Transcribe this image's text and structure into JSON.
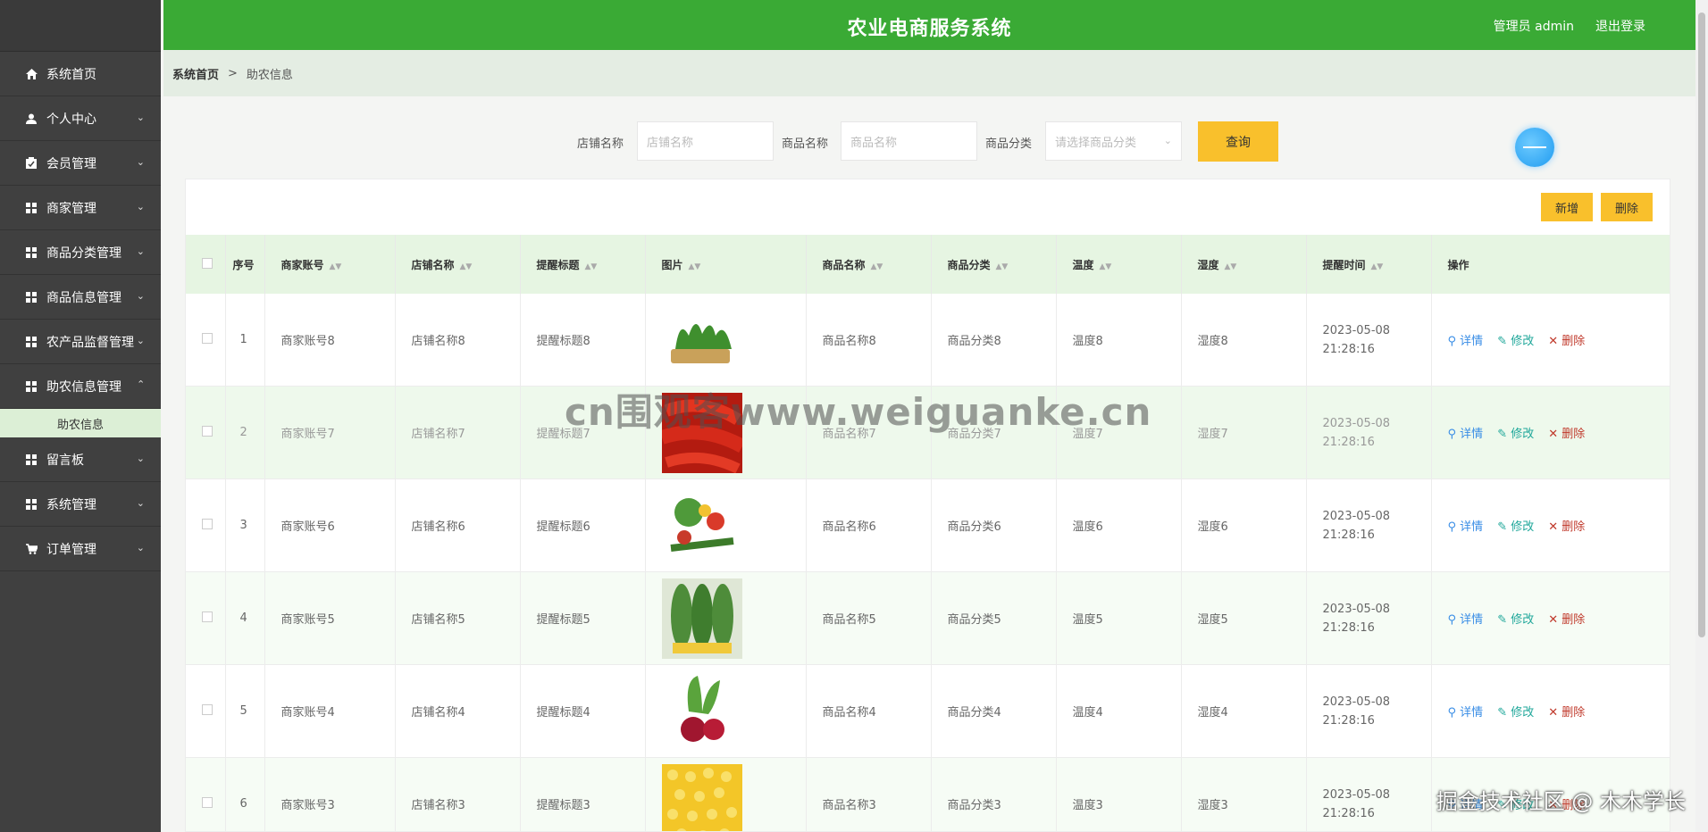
{
  "header": {
    "title": "农业电商服务系统",
    "user": "管理员 admin",
    "logout": "退出登录"
  },
  "sidebar": {
    "items": [
      {
        "label": "系统首页",
        "icon": "home-icon"
      },
      {
        "label": "个人中心",
        "icon": "user-icon"
      },
      {
        "label": "会员管理",
        "icon": "clipboard-icon"
      },
      {
        "label": "商家管理",
        "icon": "grid-icon"
      },
      {
        "label": "商品分类管理",
        "icon": "grid-icon"
      },
      {
        "label": "商品信息管理",
        "icon": "grid-icon"
      },
      {
        "label": "农产品监督管理",
        "icon": "grid-icon"
      },
      {
        "label": "助农信息管理",
        "icon": "grid-icon"
      },
      {
        "label": "留言板",
        "icon": "grid-icon"
      },
      {
        "label": "系统管理",
        "icon": "grid-icon"
      },
      {
        "label": "订单管理",
        "icon": "cart-icon"
      }
    ],
    "active_sub": "助农信息"
  },
  "breadcrumb": {
    "home": "系统首页",
    "sep": ">",
    "current": "助农信息"
  },
  "search": {
    "shop_label": "店铺名称",
    "shop_placeholder": "店铺名称",
    "product_label": "商品名称",
    "product_placeholder": "商品名称",
    "category_label": "商品分类",
    "category_placeholder": "请选择商品分类",
    "query": "查询"
  },
  "actions": {
    "add": "新增",
    "delete": "删除"
  },
  "table": {
    "headers": [
      "序号",
      "商家账号",
      "店铺名称",
      "提醒标题",
      "图片",
      "商品名称",
      "商品分类",
      "温度",
      "湿度",
      "提醒时间",
      "操作"
    ],
    "ops": {
      "detail": "详情",
      "edit": "修改",
      "delete": "删除"
    },
    "rows": [
      {
        "no": "1",
        "account": "商家账号8",
        "shop": "店铺名称8",
        "title": "提醒标题8",
        "image": "greens-basket",
        "product": "商品名称8",
        "category": "商品分类8",
        "temp": "温度8",
        "humidity": "湿度8",
        "time": "2023-05-08 21:28:16"
      },
      {
        "no": "2",
        "account": "商家账号7",
        "shop": "店铺名称7",
        "title": "提醒标题7",
        "image": "red-peppers",
        "product": "商品名称7",
        "category": "商品分类7",
        "temp": "温度7",
        "humidity": "湿度7",
        "time": "2023-05-08 21:28:16"
      },
      {
        "no": "3",
        "account": "商家账号6",
        "shop": "店铺名称6",
        "title": "提醒标题6",
        "image": "mixed-vegetables",
        "product": "商品名称6",
        "category": "商品分类6",
        "temp": "温度6",
        "humidity": "湿度6",
        "time": "2023-05-08 21:28:16"
      },
      {
        "no": "4",
        "account": "商家账号5",
        "shop": "店铺名称5",
        "title": "提醒标题5",
        "image": "corn",
        "product": "商品名称5",
        "category": "商品分类5",
        "temp": "温度5",
        "humidity": "湿度5",
        "time": "2023-05-08 21:28:16"
      },
      {
        "no": "5",
        "account": "商家账号4",
        "shop": "店铺名称4",
        "title": "提醒标题4",
        "image": "beetroot",
        "product": "商品名称4",
        "category": "商品分类4",
        "temp": "温度4",
        "humidity": "湿度4",
        "time": "2023-05-08 21:28:16"
      },
      {
        "no": "6",
        "account": "商家账号3",
        "shop": "店铺名称3",
        "title": "提醒标题3",
        "image": "corn-kernels",
        "product": "商品名称3",
        "category": "商品分类3",
        "temp": "温度3",
        "humidity": "湿度3",
        "time": "2023-05-08 21:28:16"
      }
    ]
  },
  "watermark": "cn围观客www.weiguanke.cn",
  "footer_mark": "掘金技术社区 @ 木木学长",
  "colors": {
    "header": "#3aaa35",
    "sidebar": "#404040",
    "accent_button": "#f9c02c",
    "table_header": "#e6f5e2"
  }
}
